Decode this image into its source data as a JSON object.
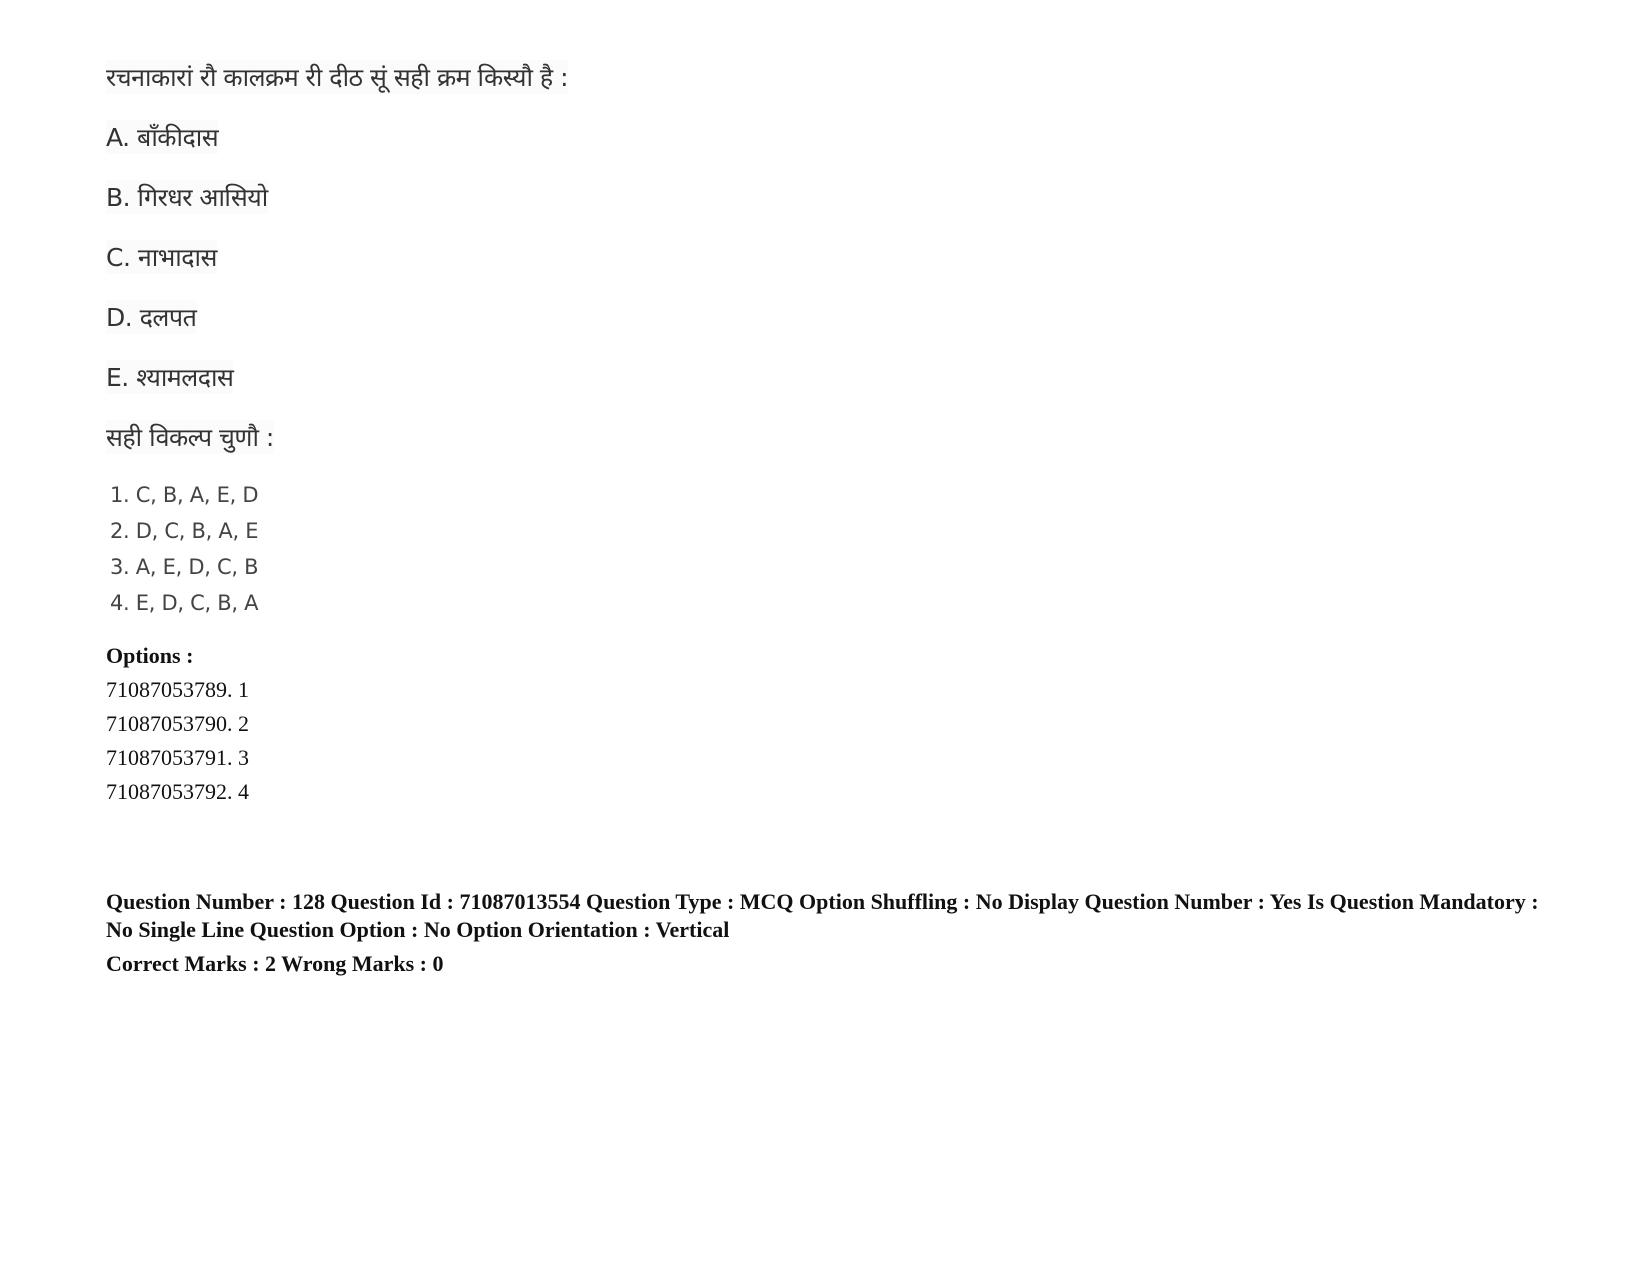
{
  "question": {
    "stem": "रचनाकारां रौ कालक्रम री दीठ सूं सही क्रम किस्यौ है :",
    "items": [
      {
        "label": "A. बाँकीदास"
      },
      {
        "label": "B. गिरधर आसियो"
      },
      {
        "label": "C. नाभादास"
      },
      {
        "label": "D. दलपत"
      },
      {
        "label": "E. श्यामलदास"
      }
    ],
    "instruction": "सही विकल्प चुणौ :",
    "choices": [
      {
        "label": "1. C, B, A, E, D"
      },
      {
        "label": "2. D, C, B, A, E"
      },
      {
        "label": "3. A, E, D, C, B"
      },
      {
        "label": "4. E, D, C, B, A"
      }
    ]
  },
  "options": {
    "heading": "Options :",
    "list": [
      {
        "label": "71087053789. 1"
      },
      {
        "label": "71087053790. 2"
      },
      {
        "label": "71087053791. 3"
      },
      {
        "label": "71087053792. 4"
      }
    ]
  },
  "next_question_meta": {
    "details": "Question Number : 128 Question Id : 71087013554 Question Type : MCQ Option Shuffling : No Display Question Number : Yes Is Question Mandatory : No Single Line Question Option : No Option Orientation : Vertical",
    "marks": "Correct Marks : 2 Wrong Marks : 0"
  }
}
